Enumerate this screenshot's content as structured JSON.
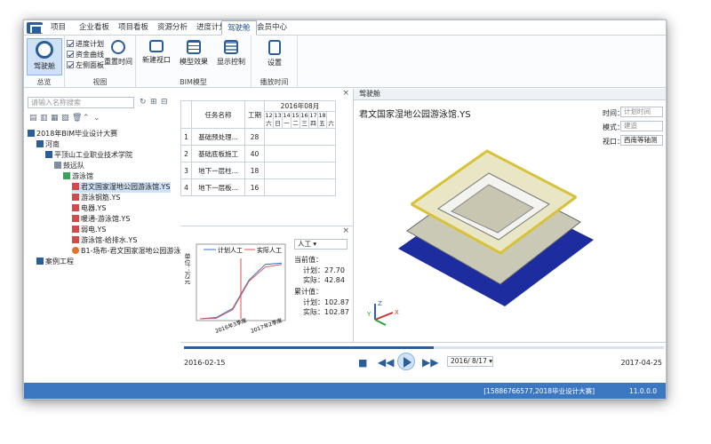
{
  "tabs": [
    "项目",
    "企业看板",
    "项目看板",
    "资源分析",
    "进度计划",
    "驾驶舱",
    "会员中心"
  ],
  "active_tab": 5,
  "ribbon": {
    "cockpit": {
      "label": "驾驶舱",
      "group": "总览"
    },
    "view": {
      "checks": [
        "进度计划",
        "资金曲线",
        "左侧面板"
      ],
      "reset": "重置时间",
      "group": "视图"
    },
    "bim": {
      "buttons": [
        "新建视口",
        "模型效果",
        "显示控制"
      ],
      "group": "BIM模型"
    },
    "play": {
      "settings": "设置",
      "group": "播放时间"
    }
  },
  "search_placeholder": "请输入名称搜索",
  "tree": [
    {
      "label": "2018年BIM毕业设计大赛",
      "level": 0
    },
    {
      "label": "河南",
      "level": 1
    },
    {
      "label": "平顶山工业职业技术学院",
      "level": 2
    },
    {
      "label": "鼓远队",
      "level": 3
    },
    {
      "label": "游泳馆",
      "level": 4
    },
    {
      "label": "君文国家湿地公园游泳馆.YS",
      "level": 5,
      "selected": true
    },
    {
      "label": "游泳钢筋.YS",
      "level": 5
    },
    {
      "label": "电器.YS",
      "level": 5
    },
    {
      "label": "暖通-游泳馆.YS",
      "level": 5
    },
    {
      "label": "弱电.YS",
      "level": 5
    },
    {
      "label": "游泳馆-给排水.YS",
      "level": 5
    },
    {
      "label": "B1-场布-君文国家湿地公园游泳馆.YS",
      "level": 5
    },
    {
      "label": "案例工程",
      "level": 1
    }
  ],
  "schedule": {
    "header_task": "任务名称",
    "header_duration": "工期",
    "month": "2016年08月",
    "days": [
      "12",
      "13",
      "14",
      "15",
      "16",
      "17",
      "18"
    ],
    "weekdays": [
      "六",
      "日",
      "一",
      "二",
      "三",
      "四",
      "五",
      "六"
    ],
    "rows": [
      {
        "id": "1",
        "name": "基础预处理...",
        "duration": "28"
      },
      {
        "id": "2",
        "name": "基础底板施工",
        "duration": "40"
      },
      {
        "id": "3",
        "name": "地下一层柱...",
        "duration": "18"
      },
      {
        "id": "4",
        "name": "地下一层板...",
        "duration": "16"
      }
    ]
  },
  "curve": {
    "legend": [
      "计划人工",
      "实际人工"
    ],
    "unit": "单位：万元",
    "resource": "人工",
    "current_label": "当前值：",
    "plan_label": "计划：",
    "actual_label": "实际：",
    "cur_plan": "27.70",
    "cur_actual": "42.84",
    "cum_label": "累计值：",
    "cum_plan": "102.87",
    "cum_actual": "102.87",
    "yticks": [
      "0",
      "20",
      "40",
      "60",
      "80",
      "100",
      "120",
      "140",
      "160",
      "180",
      "200",
      "220",
      "240"
    ],
    "xticks": [
      "2016年3季度",
      "2017年2季度"
    ],
    "chart_data": {
      "type": "line",
      "series": [
        {
          "name": "计划人工",
          "values": [
            0,
            5,
            40,
            150,
            210,
            215
          ]
        },
        {
          "name": "实际人工",
          "values": [
            0,
            2,
            35,
            145,
            200,
            210
          ]
        }
      ]
    }
  },
  "viewport": {
    "tab": "驾驶舱",
    "title": "君文国家湿地公园游泳馆.YS",
    "time_label": "时间：",
    "time_value": "计划时间",
    "mode_label": "模式：",
    "mode_value": "建造",
    "view_label": "视口：",
    "view_value": "西南等轴测",
    "axis": [
      "Z",
      "Y",
      "X"
    ]
  },
  "player": {
    "start": "2016-02-15",
    "end": "2017-04-25",
    "date_value": "2016/ 8/17",
    "progress": 0.52
  },
  "status": {
    "info": "[15886766577,2018毕业设计大赛]",
    "version": "11.0.0.0"
  }
}
